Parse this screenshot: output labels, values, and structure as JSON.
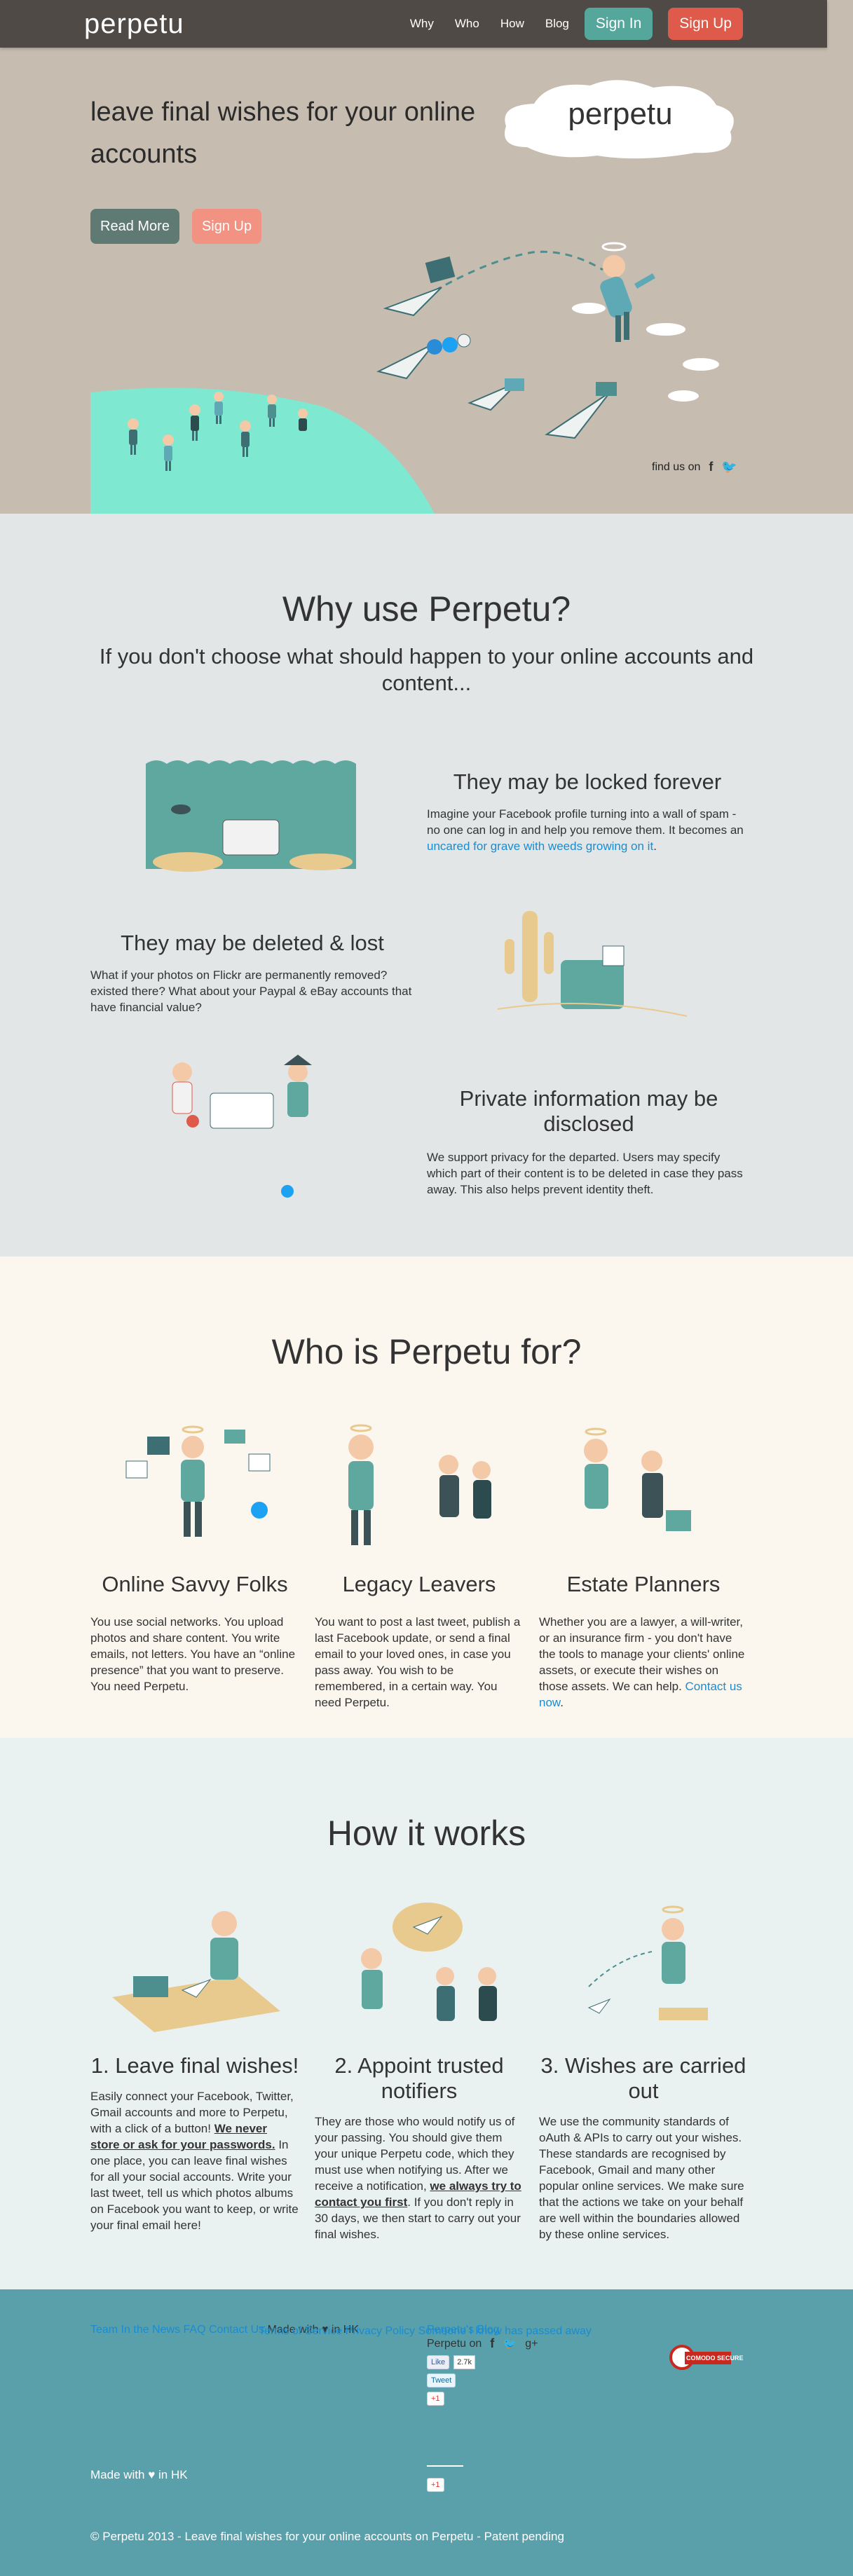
{
  "nav": {
    "brand": "perpetu",
    "links": [
      "Why",
      "Who",
      "How",
      "Blog"
    ],
    "sign_in": "Sign In",
    "sign_up": "Sign Up"
  },
  "hero": {
    "title": "leave final wishes for your online accounts",
    "read_more": "Read More",
    "sign_up": "Sign Up",
    "cloud_logo": "perpetu",
    "find_us": "find us on"
  },
  "why": {
    "title": "Why use Perpetu?",
    "subtitle": "If you don't choose what should happen to your online accounts and content...",
    "features": [
      {
        "title": "They may be locked forever",
        "text_before": "Imagine your Facebook profile turning into a wall of spam - no one can log in and help you remove them. It becomes an ",
        "link": "uncared for grave with weeds growing on it",
        "text_after": "."
      },
      {
        "title": "They may be deleted & lost",
        "text": "What if your photos on Flickr are permanently removed? existed there? What about your Paypal & eBay accounts that have financial value?"
      },
      {
        "title": "Private information may be disclosed",
        "text": "We support privacy for the departed. Users may specify which part of their content is to be deleted in case they pass away. This also helps prevent identity theft."
      }
    ]
  },
  "who": {
    "title": "Who is Perpetu for?",
    "cols": [
      {
        "title": "Online Savvy Folks",
        "text": "You use social networks. You upload photos and share content. You write emails, not letters. You have an “online presence” that you want to preserve. You need Perpetu."
      },
      {
        "title": "Legacy Leavers",
        "text": "You want to post a last tweet, publish a last Facebook update, or send a final email to your loved ones, in case you pass away. You wish to be remembered, in a certain way. You need Perpetu."
      },
      {
        "title": "Estate Planners",
        "text": "Whether you are a lawyer, a will-writer, or an insurance firm - you don't have the tools to manage your clients' online assets, or execute their wishes on those assets. We can help. ",
        "link": "Contact us now",
        "text_after": "."
      }
    ]
  },
  "how": {
    "title": "How it works",
    "cols": [
      {
        "title": "1. Leave final wishes!",
        "text_1": "Easily connect your Facebook, Twitter, Gmail accounts and more to Perpetu, with a click of a button! ",
        "strong": "We never store or ask for your passwords.",
        "text_2": " In one place, you can leave final wishes for all your social accounts. Write your last tweet, tell us which photos albums on Facebook you want to keep, or write your final email here!"
      },
      {
        "title": "2. Appoint trusted notifiers",
        "text_1": "They are those who would notify us of your passing. You should give them your unique Perpetu code, which they must use when notifying us. After we receive a notification, ",
        "strong": "we always try to contact you first",
        "text_2": ". If you don't reply in 30 days, we then start to carry out your final wishes."
      },
      {
        "title": "3. Wishes are carried out",
        "text": "We use the community standards of oAuth & APIs to carry out your wishes. These standards are recognised by Facebook, Gmail and many other popular online services. We make sure that the actions we take on your behalf are well within the boundaries allowed by these online services."
      }
    ]
  },
  "footer": {
    "col1": [
      "Team",
      "In the News",
      "FAQ",
      "Contact Us"
    ],
    "made_with_1": "Made with ♥ in HK",
    "made_with_2": "Made with ♥ in HK",
    "col2": [
      "Terms of Service",
      "Privacy Policy",
      "Someone I know has passed away"
    ],
    "blog": "Perpetu's Blog",
    "perpetu_on": "Perpetu on",
    "fb_like": "Like",
    "fb_count": "2.7k",
    "tweet": "Tweet",
    "gplus": "+1",
    "gplus_2": "+1",
    "badge_text": "COMODO SECURE",
    "copyright": "© Perpetu 2013 - Leave final wishes for your online accounts on Perpetu - Patent pending"
  },
  "colors": {
    "nav_bg": "#4f4a46",
    "hero_bg": "#c6bcb0",
    "teal": "#56a79b",
    "red": "#de5a4a",
    "mint": "#7ee8d0",
    "footer_bg": "#5aa0ab",
    "link": "#1a8ccf"
  }
}
